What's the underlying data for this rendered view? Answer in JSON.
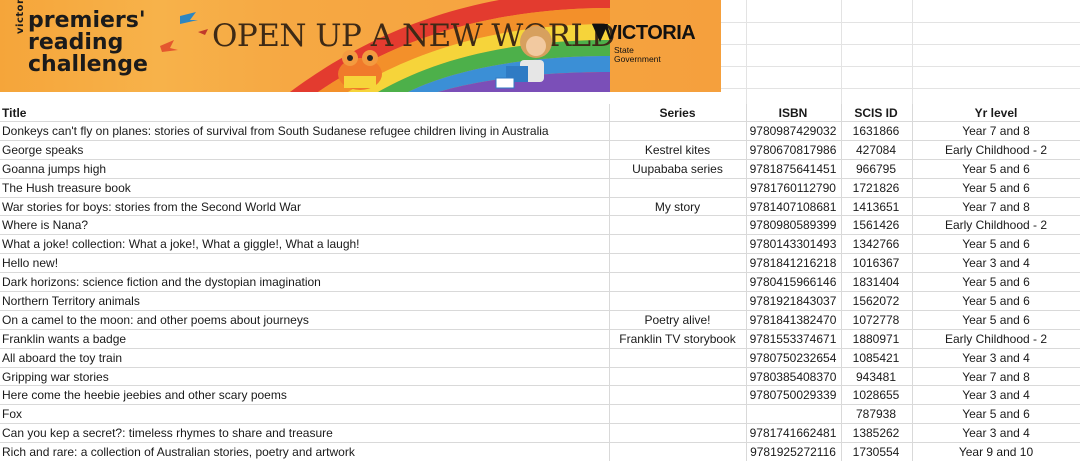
{
  "banner": {
    "brand_victorian": "victorian",
    "brand_line1": "premiers'",
    "brand_line2": "reading",
    "brand_line3": "challenge",
    "headline": "OPEN UP A NEW WORLD",
    "gov_word": "VICTORIA",
    "gov_sub1": "State",
    "gov_sub2": "Government"
  },
  "table": {
    "headers": {
      "title": "Title",
      "series": "Series",
      "isbn": "ISBN",
      "scis": "SCIS ID",
      "yr": "Yr level"
    },
    "rows": [
      {
        "title": "Donkeys can't fly on planes: stories of survival from South Sudanese refugee children living in Australia",
        "series": "",
        "isbn": "9780987429032",
        "scis": "1631866",
        "yr": "Year 7 and 8"
      },
      {
        "title": "George speaks",
        "series": "Kestrel kites",
        "isbn": "9780670817986",
        "scis": "427084",
        "yr": "Early Childhood - 2"
      },
      {
        "title": "Goanna jumps high",
        "series": "Uupababa series",
        "isbn": "9781875641451",
        "scis": "966795",
        "yr": "Year 5 and 6"
      },
      {
        "title": "The Hush treasure book",
        "series": "",
        "isbn": "9781760112790",
        "scis": "1721826",
        "yr": "Year 5 and 6"
      },
      {
        "title": "War stories for boys: stories from the Second World War",
        "series": "My story",
        "isbn": "9781407108681",
        "scis": "1413651",
        "yr": "Year 7 and 8"
      },
      {
        "title": "Where is Nana?",
        "series": "",
        "isbn": "9780980589399",
        "scis": "1561426",
        "yr": "Early Childhood - 2"
      },
      {
        "title": "What a joke! collection: What a joke!, What a giggle!, What a laugh!",
        "series": "",
        "isbn": "9780143301493",
        "scis": "1342766",
        "yr": "Year 5 and 6"
      },
      {
        "title": "Hello new!",
        "series": "",
        "isbn": "9781841216218",
        "scis": "1016367",
        "yr": "Year 3 and 4"
      },
      {
        "title": "Dark horizons: science fiction and the dystopian imagination",
        "series": "",
        "isbn": "9780415966146",
        "scis": "1831404",
        "yr": "Year 5 and 6"
      },
      {
        "title": "Northern Territory animals",
        "series": "",
        "isbn": "9781921843037",
        "scis": "1562072",
        "yr": "Year 5 and 6"
      },
      {
        "title": "On a camel to the moon: and other poems about journeys",
        "series": "Poetry alive!",
        "isbn": "9781841382470",
        "scis": "1072778",
        "yr": "Year 5 and 6"
      },
      {
        "title": "Franklin wants a badge",
        "series": "Franklin TV storybook",
        "isbn": "9781553374671",
        "scis": "1880971",
        "yr": "Early Childhood - 2"
      },
      {
        "title": "All aboard the toy train",
        "series": "",
        "isbn": "9780750232654",
        "scis": "1085421",
        "yr": "Year 3 and 4"
      },
      {
        "title": "Gripping war stories",
        "series": "",
        "isbn": "9780385408370",
        "scis": "943481",
        "yr": "Year 7 and 8"
      },
      {
        "title": "Here come the heebie jeebies and other scary poems",
        "series": "",
        "isbn": "9780750029339",
        "scis": "1028655",
        "yr": "Year 3 and 4"
      },
      {
        "title": "Fox",
        "series": "",
        "isbn": "",
        "scis": "787938",
        "yr": "Year 5 and 6"
      },
      {
        "title": "Can you kep a secret?: timeless rhymes to share and treasure",
        "series": "",
        "isbn": "9781741662481",
        "scis": "1385262",
        "yr": "Year 3 and 4"
      },
      {
        "title": "Rich and rare: a collection of Australian stories, poetry and artwork",
        "series": "",
        "isbn": "9781925272116",
        "scis": "1730554",
        "yr": "Year 9 and 10"
      }
    ]
  },
  "colors": {
    "banner_orange": "#f5a53a",
    "grid": "#d9d9d9"
  }
}
